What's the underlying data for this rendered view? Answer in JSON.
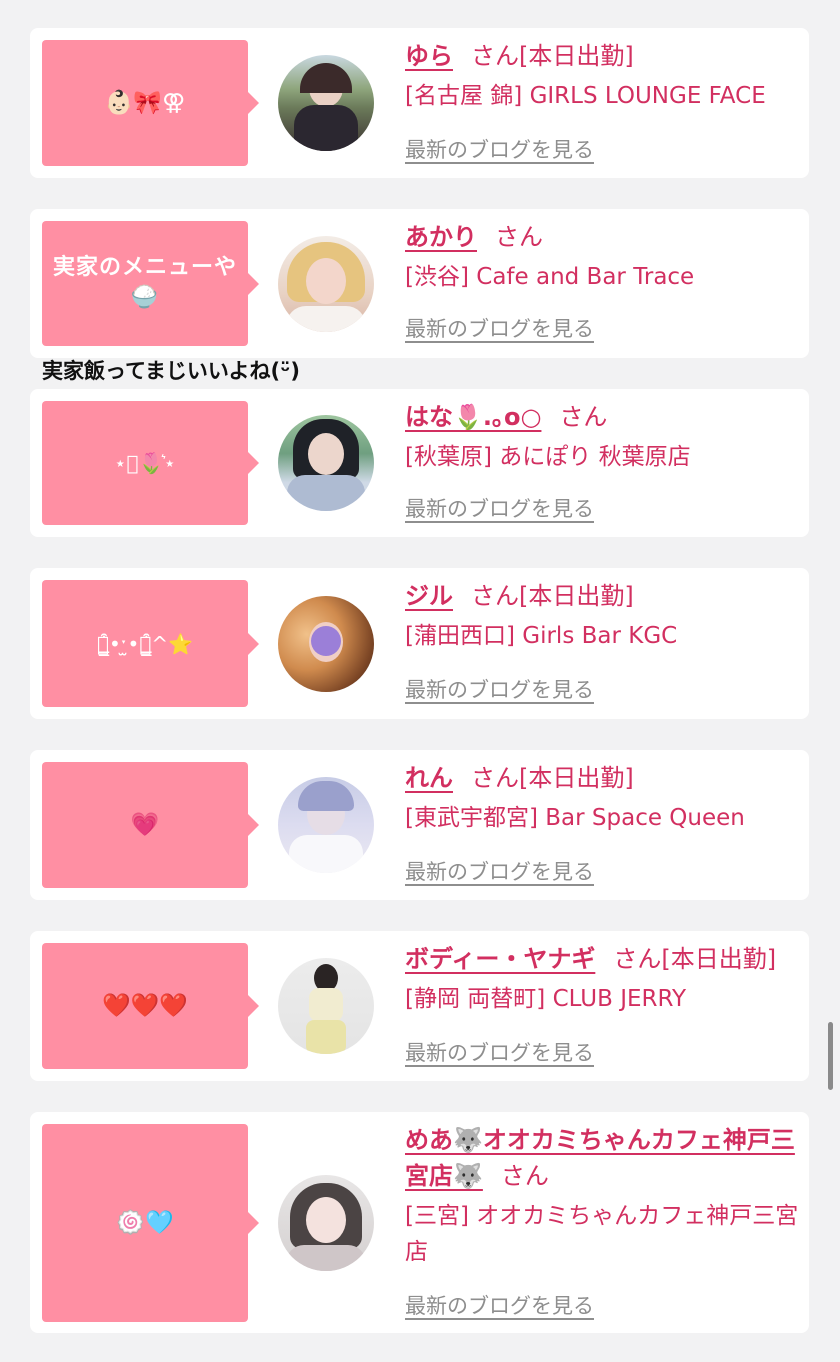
{
  "overflow_comment": "実家飯ってまじいいよね(ᵕ̈)",
  "common": {
    "san": "さん",
    "blog_link": "最新のブログを見る"
  },
  "cards": [
    {
      "bubble": "👶🏻🎀⚢",
      "name": "ゆら",
      "status": "[本日出勤]",
      "shop": "[名古屋 錦] GIRLS LOUNGE FACE"
    },
    {
      "bubble": "実家のメニューや🍚",
      "name": "あかり",
      "status": "",
      "shop": "[渋谷] Cafe and Bar Trace"
    },
    {
      "bubble": "⋆͛🌷͛⋆",
      "name": "はな🌷.｡o○",
      "status": "",
      "shop": "[秋葉原] あにぽり 秋葉原店"
    },
    {
      "bubble": "ฅ̳͒•ˑ̫•ฅ̳͒^⭐️",
      "name": "ジル",
      "status": "[本日出勤]",
      "shop": "[蒲田西口] Girls Bar KGC"
    },
    {
      "bubble": "💗",
      "name": "れん",
      "status": "[本日出勤]",
      "shop": "[東武宇都宮] Bar Space Queen"
    },
    {
      "bubble": "❤️❤️❤️",
      "name": "ボディー・ヤナギ",
      "status": "[本日出勤]",
      "shop": "[静岡 両替町] CLUB JERRY"
    },
    {
      "bubble": "🍥🩵",
      "name": "めあ🐺オオカミちゃんカフェ神戸三宮店🐺",
      "status": "",
      "shop": "[三宮] オオカミちゃんカフェ神戸三宮店"
    }
  ]
}
